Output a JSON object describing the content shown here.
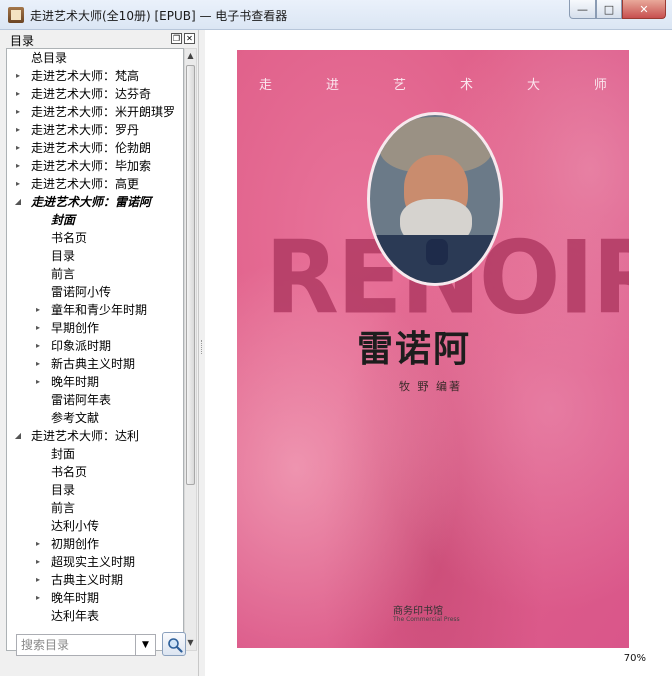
{
  "window": {
    "title": "走进艺术大师(全10册) [EPUB] — 电子书查看器",
    "buttons": {
      "minimize": "—",
      "maximize": "□",
      "close": "✕"
    }
  },
  "toc": {
    "title": "目录",
    "items": [
      {
        "label": "总目录",
        "level": 0,
        "arrow": ""
      },
      {
        "label": "走进艺术大师：梵高",
        "level": 0,
        "arrow": "▸"
      },
      {
        "label": "走进艺术大师：达芬奇",
        "level": 0,
        "arrow": "▸"
      },
      {
        "label": "走进艺术大师：米开朗琪罗",
        "level": 0,
        "arrow": "▸"
      },
      {
        "label": "走进艺术大师：罗丹",
        "level": 0,
        "arrow": "▸"
      },
      {
        "label": "走进艺术大师：伦勃朗",
        "level": 0,
        "arrow": "▸"
      },
      {
        "label": "走进艺术大师：毕加索",
        "level": 0,
        "arrow": "▸"
      },
      {
        "label": "走进艺术大师：高更",
        "level": 0,
        "arrow": "▸"
      },
      {
        "label": "走进艺术大师：雷诺阿",
        "level": 0,
        "arrow": "◢",
        "style": "bold-italic"
      },
      {
        "label": "封面",
        "level": 1,
        "arrow": "",
        "style": "bold-italic"
      },
      {
        "label": "书名页",
        "level": 1,
        "arrow": ""
      },
      {
        "label": "目录",
        "level": 1,
        "arrow": ""
      },
      {
        "label": "前言",
        "level": 1,
        "arrow": ""
      },
      {
        "label": "雷诺阿小传",
        "level": 1,
        "arrow": ""
      },
      {
        "label": "童年和青少年时期",
        "level": 1,
        "arrow": "▸"
      },
      {
        "label": "早期创作",
        "level": 1,
        "arrow": "▸"
      },
      {
        "label": "印象派时期",
        "level": 1,
        "arrow": "▸"
      },
      {
        "label": "新古典主义时期",
        "level": 1,
        "arrow": "▸"
      },
      {
        "label": "晚年时期",
        "level": 1,
        "arrow": "▸"
      },
      {
        "label": "雷诺阿年表",
        "level": 1,
        "arrow": ""
      },
      {
        "label": "参考文献",
        "level": 1,
        "arrow": ""
      },
      {
        "label": "走进艺术大师：达利",
        "level": 0,
        "arrow": "◢"
      },
      {
        "label": "封面",
        "level": 1,
        "arrow": ""
      },
      {
        "label": "书名页",
        "level": 1,
        "arrow": ""
      },
      {
        "label": "目录",
        "level": 1,
        "arrow": ""
      },
      {
        "label": "前言",
        "level": 1,
        "arrow": ""
      },
      {
        "label": "达利小传",
        "level": 1,
        "arrow": ""
      },
      {
        "label": "初期创作",
        "level": 1,
        "arrow": "▸"
      },
      {
        "label": "超现实主义时期",
        "level": 1,
        "arrow": "▸"
      },
      {
        "label": "古典主义时期",
        "level": 1,
        "arrow": "▸"
      },
      {
        "label": "晚年时期",
        "level": 1,
        "arrow": "▸"
      },
      {
        "label": "达利年表",
        "level": 1,
        "arrow": ""
      }
    ],
    "search_placeholder": "搜索目录"
  },
  "cover": {
    "series_chars": [
      "走",
      "进",
      "艺",
      "术",
      "大",
      "师"
    ],
    "latin_name": "RENOIR",
    "chinese_name": "雷诺阿",
    "author": "牧  野 编著",
    "publisher": "商务印书馆",
    "publisher_en": "The Commercial Press"
  },
  "status": {
    "zoom": "70%"
  },
  "colors": {
    "cover_pink": "#e0608a",
    "latin_name": "#b13a63"
  }
}
